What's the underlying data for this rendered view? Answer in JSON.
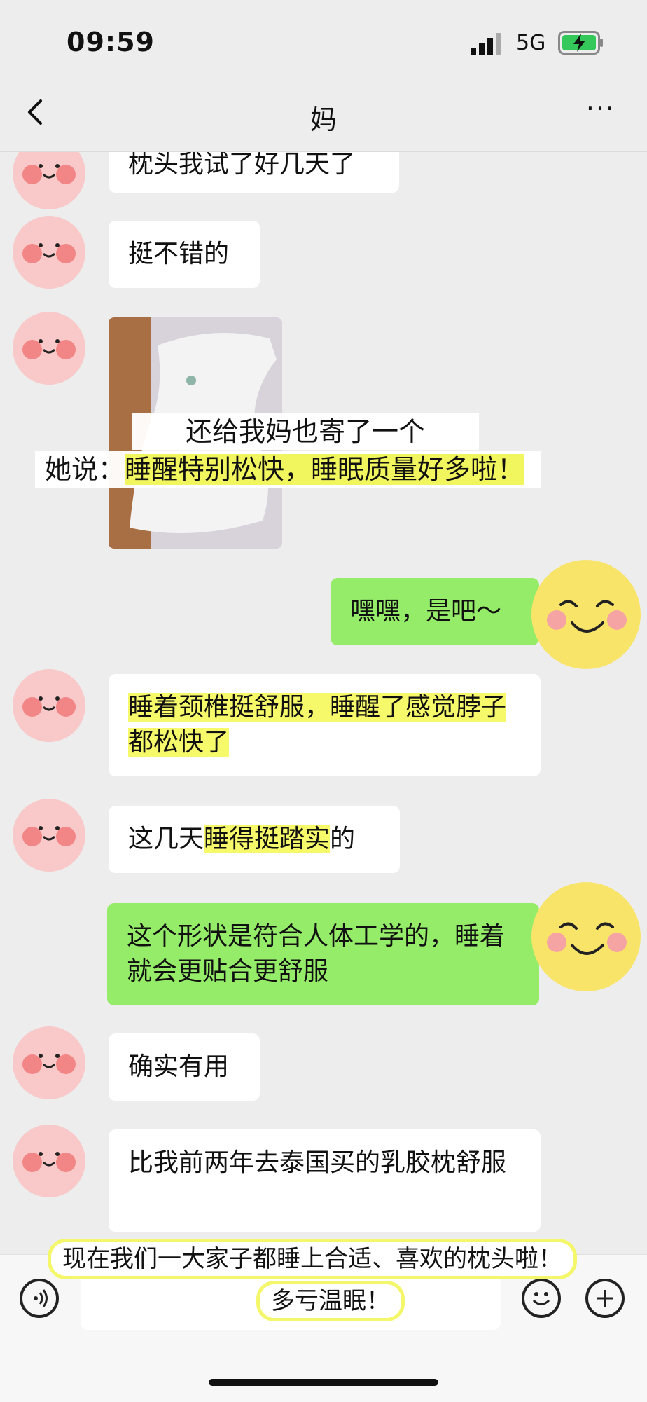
{
  "status_bar": {
    "time": "09:59",
    "network": "5G"
  },
  "header": {
    "title": "妈",
    "more": "···"
  },
  "messages": {
    "m1": "枕头我试了好几天了",
    "m2": "挺不错的",
    "m4": "嘿嘿，是吧～",
    "m5": "睡着颈椎挺舒服，睡醒了感觉脖子都松快了",
    "m6a": "这几天",
    "m6b": "睡得挺踏实",
    "m6c": "的",
    "m7": "这个形状是符合人体工学的，睡着就会更贴合更舒服",
    "m8": "确实有用",
    "m9": "比我前两年去泰国买的乳胶枕舒服"
  },
  "overlay": {
    "line1": "还给我妈也寄了一个",
    "line2_prefix": "她说：",
    "line2_highlight": "睡醒特别松快，睡眠质量好多啦！"
  },
  "caption": {
    "line1": "现在我们一大家子都睡上合适、喜欢的枕头啦！",
    "line2": "多亏温眠！"
  },
  "colors": {
    "own_bubble": "#95ec69",
    "highlight": "#f6f96a",
    "background": "#ededed"
  }
}
